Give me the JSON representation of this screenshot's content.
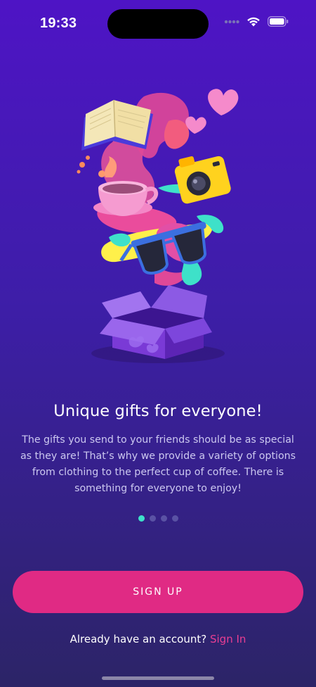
{
  "status_bar": {
    "time": "19:33",
    "icons": [
      "signal-dots-icon",
      "wifi-icon",
      "battery-icon"
    ]
  },
  "illustration": {
    "items": [
      "book-icon",
      "hearts-icon",
      "camera-icon",
      "coffee-cup-icon",
      "sunglasses-icon",
      "gift-box-icon"
    ]
  },
  "onboarding": {
    "title": "Unique gifts for everyone!",
    "description_lines": [
      "The gifts you send to your friends should be as special",
      "as they are! That’s why we provide a variety of options",
      "from clothing to the perfect cup of coffee. There is",
      "something for everyone to enjoy!"
    ],
    "page_count": 4,
    "active_page": 1
  },
  "actions": {
    "sign_up_label": "SIGN UP",
    "sign_in_prompt": "Already have an account?",
    "sign_in_link": "Sign In"
  },
  "colors": {
    "background_top": "#4e14c5",
    "background_bottom": "#2c2467",
    "accent_pink": "#e02a84",
    "active_dot": "#3ee1c9",
    "inactive_dot": "#5a52a4"
  }
}
